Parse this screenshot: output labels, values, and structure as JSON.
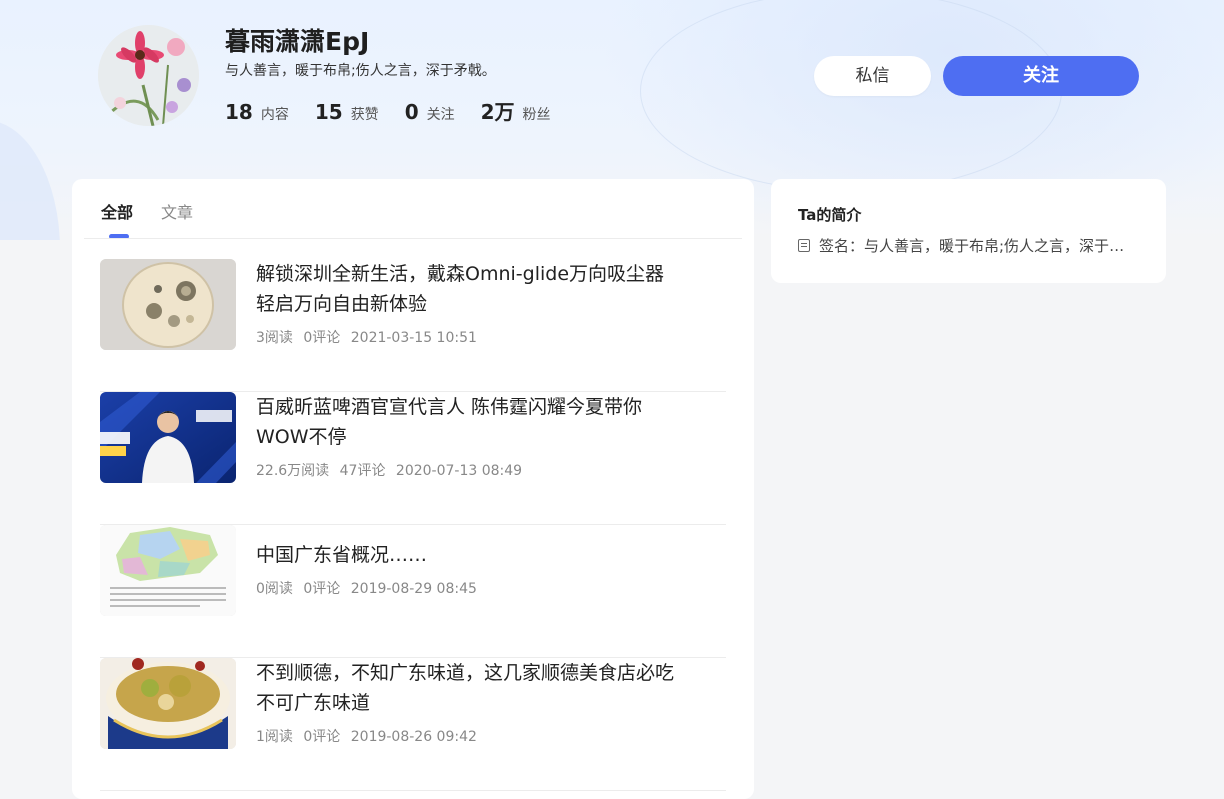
{
  "profile": {
    "name": "暮雨潇潇EpJ",
    "signature": "与人善言，暖于布帛;伤人之言，深于矛戟。",
    "stats": [
      {
        "num": "18",
        "label": "内容"
      },
      {
        "num": "15",
        "label": "获赞"
      },
      {
        "num": "0",
        "label": "关注"
      },
      {
        "num": "2万",
        "label": "粉丝"
      }
    ],
    "message_label": "私信",
    "follow_label": "关注"
  },
  "tabs": [
    {
      "label": "全部",
      "active": true
    },
    {
      "label": "文章",
      "active": false
    }
  ],
  "feed": [
    {
      "title": "解锁深圳全新生活，戴森Omni-glide万向吸尘器轻启万向自由新体验",
      "reads": "3阅读",
      "comments": "0评论",
      "time": "2021-03-15 10:51",
      "thumb": "petri-dish"
    },
    {
      "title": "百威昕蓝啤酒官宣代言人 陈伟霆闪耀今夏带你WOW不停",
      "reads": "22.6万阅读",
      "comments": "47评论",
      "time": "2020-07-13 08:49",
      "thumb": "spokesperson"
    },
    {
      "title": "中国广东省概况……",
      "reads": "0阅读",
      "comments": "0评论",
      "time": "2019-08-29 08:45",
      "thumb": "map"
    },
    {
      "title": "不到顺德，不知广东味道，这几家顺德美食店必吃不可广东味道",
      "reads": "1阅读",
      "comments": "0评论",
      "time": "2019-08-26 09:42",
      "thumb": "soup-bowl"
    }
  ],
  "side": {
    "title": "Ta的简介",
    "signature_line": "签名：与人善言，暖于布帛;伤人之言，深于矛戟。"
  },
  "colors": {
    "accent": "#4e6ef2"
  }
}
